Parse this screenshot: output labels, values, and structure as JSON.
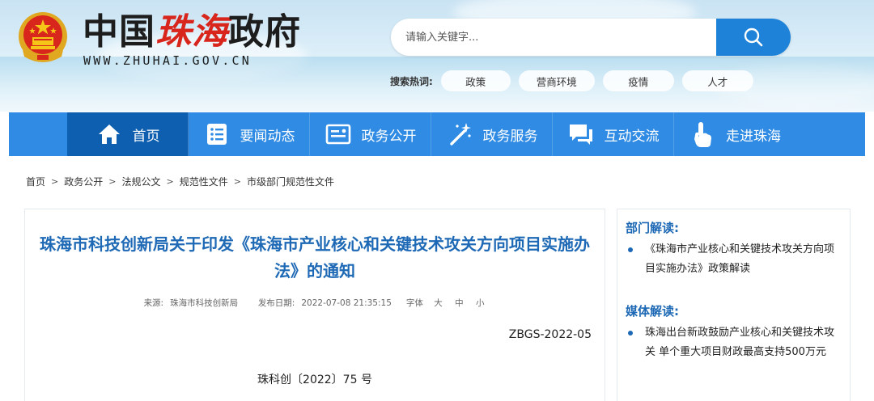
{
  "header": {
    "logo_prefix": "中国",
    "logo_mid": "珠海",
    "logo_suffix": "政府",
    "site_url": "WWW.ZHUHAI.GOV.CN",
    "emblem_icon": "national-emblem-icon"
  },
  "search": {
    "placeholder": "请输入关键字...",
    "button_icon": "search-icon",
    "hot_label": "搜索热词:",
    "hot_tags": [
      "政策",
      "营商环境",
      "疫情",
      "人才"
    ]
  },
  "nav": {
    "items": [
      {
        "label": "首页",
        "icon": "home-icon"
      },
      {
        "label": "要闻动态",
        "icon": "news-list-icon"
      },
      {
        "label": "政务公开",
        "icon": "document-icon"
      },
      {
        "label": "政务服务",
        "icon": "magic-wand-icon"
      },
      {
        "label": "互动交流",
        "icon": "chat-icon"
      },
      {
        "label": "走进珠海",
        "icon": "pointer-hand-icon"
      }
    ],
    "active_color": "#0e5fb0",
    "bar_color": "#2f8be3"
  },
  "breadcrumb": [
    "首页",
    "政务公开",
    "法规公文",
    "规范性文件",
    "市级部门规范性文件"
  ],
  "article": {
    "title": "珠海市科技创新局关于印发《珠海市产业核心和关键技术攻关方向项目实施办法》的通知",
    "source_label": "来源:",
    "source": "珠海市科技创新局",
    "date_label": "发布日期:",
    "date": "2022-07-08 21:35:15",
    "font_label": "字体",
    "font_sizes": [
      "大",
      "中",
      "小"
    ],
    "doc_number": "ZBGS-2022-05",
    "doc_code": "珠科创〔2022〕75 号"
  },
  "sidebar": {
    "dept_heading": "部门解读:",
    "dept_items": [
      "《珠海市产业核心和关键技术攻关方向项目实施办法》政策解读"
    ],
    "media_heading": "媒体解读:",
    "media_items": [
      "珠海出台新政鼓励产业核心和关键技术攻关 单个重大项目财政最高支持500万元"
    ]
  },
  "colors": {
    "title_blue": "#1e69b5",
    "search_button": "#1d82d8",
    "logo_red": "#d8261c"
  }
}
